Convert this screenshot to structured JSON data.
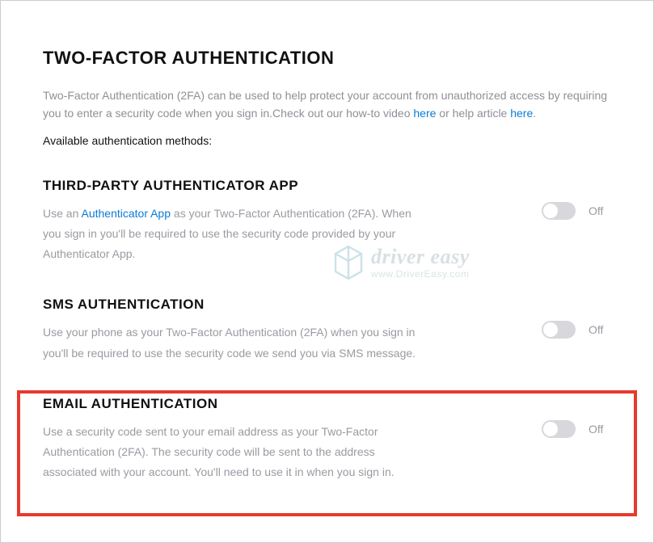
{
  "page": {
    "title": "TWO-FACTOR AUTHENTICATION",
    "intro_1": "Two-Factor Authentication (2FA) can be used to help protect your account from unauthorized access by requiring you to enter a security code when you sign in.Check out our how-to video ",
    "intro_link_1": "here",
    "intro_2": " or help article ",
    "intro_link_2": "here",
    "intro_3": ".",
    "available_label": "Available authentication methods:"
  },
  "sections": {
    "authapp": {
      "title": "THIRD-PARTY AUTHENTICATOR APP",
      "desc_1": "Use an ",
      "desc_link": "Authenticator App",
      "desc_2": " as your Two-Factor Authentication (2FA). When you sign in you'll be required to use the security code provided by your Authenticator App.",
      "state": "Off"
    },
    "sms": {
      "title": "SMS AUTHENTICATION",
      "desc": "Use your phone as your Two-Factor Authentication (2FA) when you sign in you'll be required to use the security code we send you via SMS message.",
      "state": "Off"
    },
    "email": {
      "title": "EMAIL AUTHENTICATION",
      "desc": "Use a security code sent to your email address as your Two-Factor Authentication (2FA). The security code will be sent to the address associated with your account. You'll need to use it in when you sign in.",
      "state": "Off"
    }
  },
  "watermark": {
    "main": "driver easy",
    "sub": "www.DriverEasy.com"
  }
}
